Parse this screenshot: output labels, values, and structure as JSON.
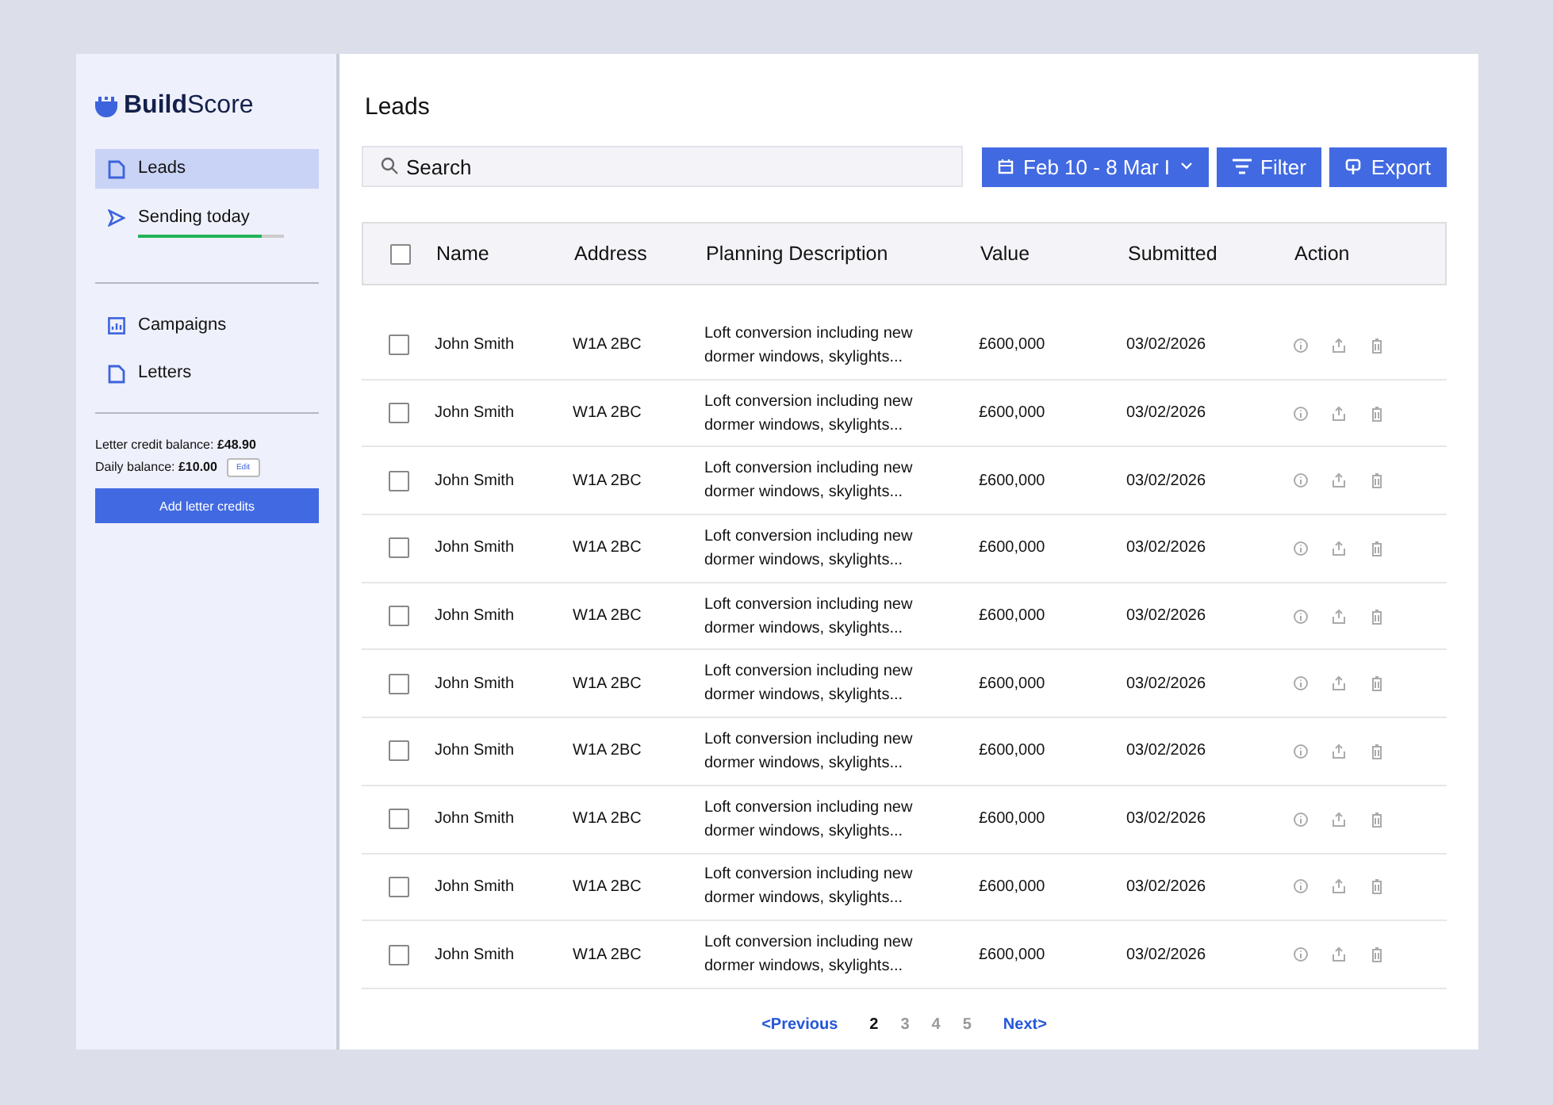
{
  "brand": "**Build**Score",
  "sidebar": {
    "items": [
      {
        "label": "Leads",
        "kind": "page",
        "selected": true
      },
      {
        "label": "Sending today",
        "kind": "send",
        "selected": false,
        "level": 0.85
      },
      {
        "label": "Campaigns",
        "kind": "chart",
        "selected": false
      },
      {
        "label": "Letters",
        "kind": "page",
        "selected": false
      }
    ],
    "credit_balance": "Letter credit balance: **£48.90**",
    "daily_balance": "Daily balance: **£10.00**",
    "edit_button": "Edit",
    "add_button": "Add letter credits"
  },
  "page_title": "Leads",
  "search": {
    "placeholder": "Search"
  },
  "toolbar": {
    "date_range": "Feb 10 - 8 Mar I",
    "filter": "Filter",
    "export": "Export"
  },
  "table": {
    "select_all_checked": false,
    "columns": [
      "Name",
      "Address",
      "Planning Description",
      "Value",
      "Submitted",
      "Action"
    ],
    "rows": [
      {
        "checked": false,
        "name": "John Smith",
        "address": "W1A 2BC",
        "description": "Loft conversion including new dormer windows, skylights...",
        "value": "£600,000",
        "submitted": "03/02/2026"
      },
      {
        "checked": false,
        "name": "John Smith",
        "address": "W1A 2BC",
        "description": "Loft conversion including new dormer windows, skylights...",
        "value": "£600,000",
        "submitted": "03/02/2026"
      },
      {
        "checked": false,
        "name": "John Smith",
        "address": "W1A 2BC",
        "description": "Loft conversion including new dormer windows, skylights...",
        "value": "£600,000",
        "submitted": "03/02/2026"
      },
      {
        "checked": false,
        "name": "John Smith",
        "address": "W1A 2BC",
        "description": "Loft conversion including new dormer windows, skylights...",
        "value": "£600,000",
        "submitted": "03/02/2026"
      },
      {
        "checked": false,
        "name": "John Smith",
        "address": "W1A 2BC",
        "description": "Loft conversion including new dormer windows, skylights...",
        "value": "£600,000",
        "submitted": "03/02/2026"
      },
      {
        "checked": false,
        "name": "John Smith",
        "address": "W1A 2BC",
        "description": "Loft conversion including new dormer windows, skylights...",
        "value": "£600,000",
        "submitted": "03/02/2026"
      },
      {
        "checked": false,
        "name": "John Smith",
        "address": "W1A 2BC",
        "description": "Loft conversion including new dormer windows, skylights...",
        "value": "£600,000",
        "submitted": "03/02/2026"
      },
      {
        "checked": false,
        "name": "John Smith",
        "address": "W1A 2BC",
        "description": "Loft conversion including new dormer windows, skylights...",
        "value": "£600,000",
        "submitted": "03/02/2026"
      },
      {
        "checked": false,
        "name": "John Smith",
        "address": "W1A 2BC",
        "description": "Loft conversion including new dormer windows, skylights...",
        "value": "£600,000",
        "submitted": "03/02/2026"
      },
      {
        "checked": false,
        "name": "John Smith",
        "address": "W1A 2BC",
        "description": "Loft conversion including new dormer windows, skylights...",
        "value": "£600,000",
        "submitted": "03/02/2026"
      }
    ]
  },
  "pagination": {
    "previous": "<Previous",
    "next": "Next>",
    "pages": [
      {
        "label": "2",
        "selected": true
      },
      {
        "label": "3",
        "selected": false
      },
      {
        "label": "4",
        "selected": false
      },
      {
        "label": "5",
        "selected": false
      }
    ]
  }
}
